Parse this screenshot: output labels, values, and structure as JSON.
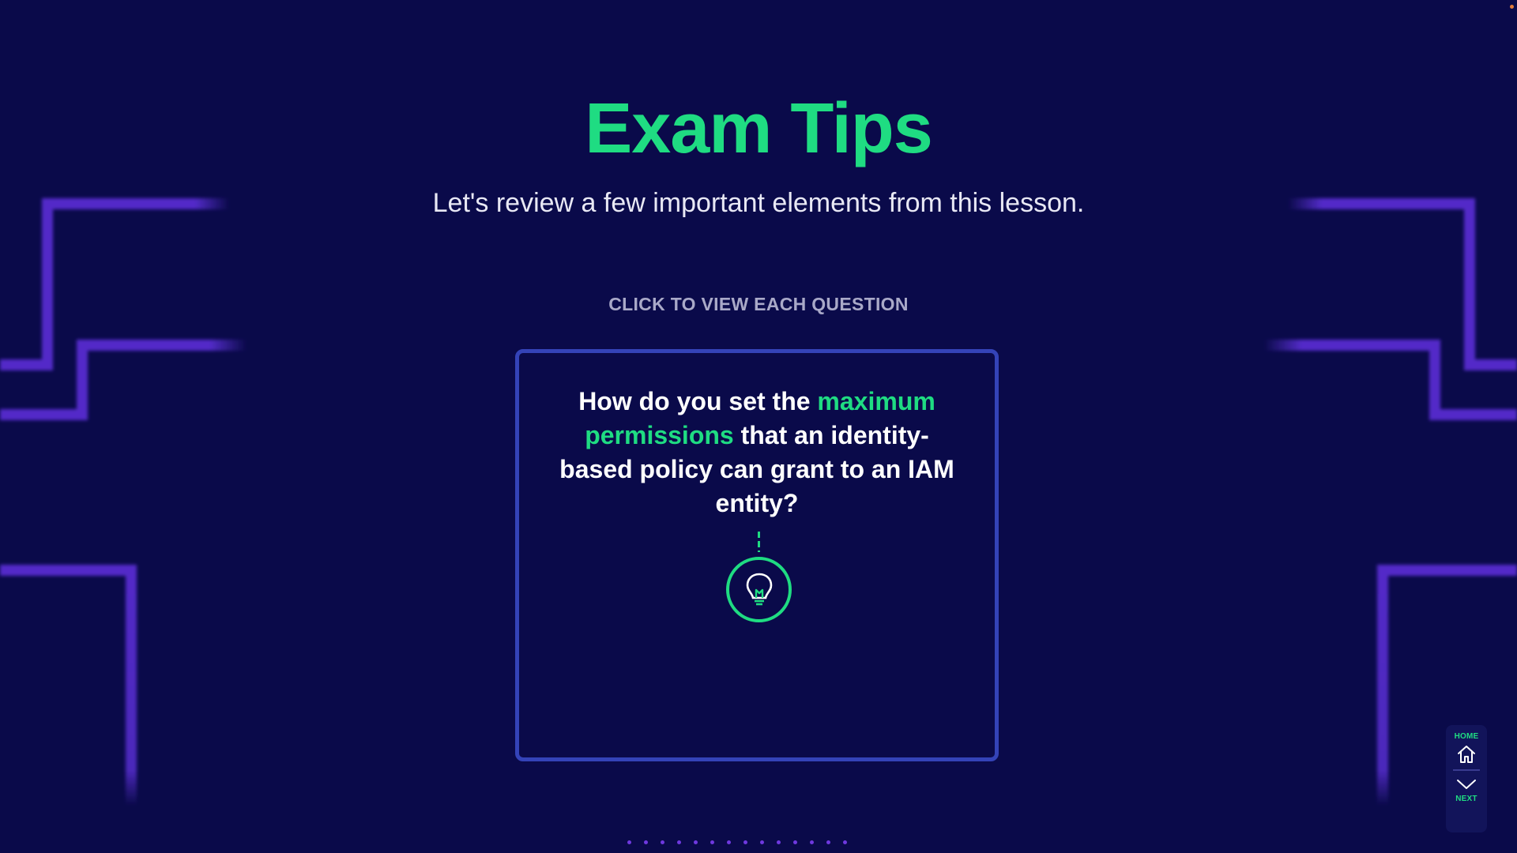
{
  "slide": {
    "title": "Exam Tips",
    "subtitle": "Let's review a few important elements from this lesson.",
    "instruction": "CLICK TO VIEW EACH QUESTION"
  },
  "card": {
    "question_part1": "How do you set the ",
    "question_highlight": "maximum permissions",
    "question_part2": " that an identity-based policy can grant to an IAM entity?",
    "reveal_icon": "lightbulb-icon"
  },
  "pagination": {
    "dot_count": 14
  },
  "nav": {
    "home_label": "HOME",
    "home_icon": "home-icon",
    "next_label": "NEXT",
    "next_icon": "chevron-down-icon"
  },
  "colors": {
    "background": "#0a0a4a",
    "accent": "#1fdc82",
    "card_border": "#3443b8",
    "circuit": "#5b2fd6"
  }
}
